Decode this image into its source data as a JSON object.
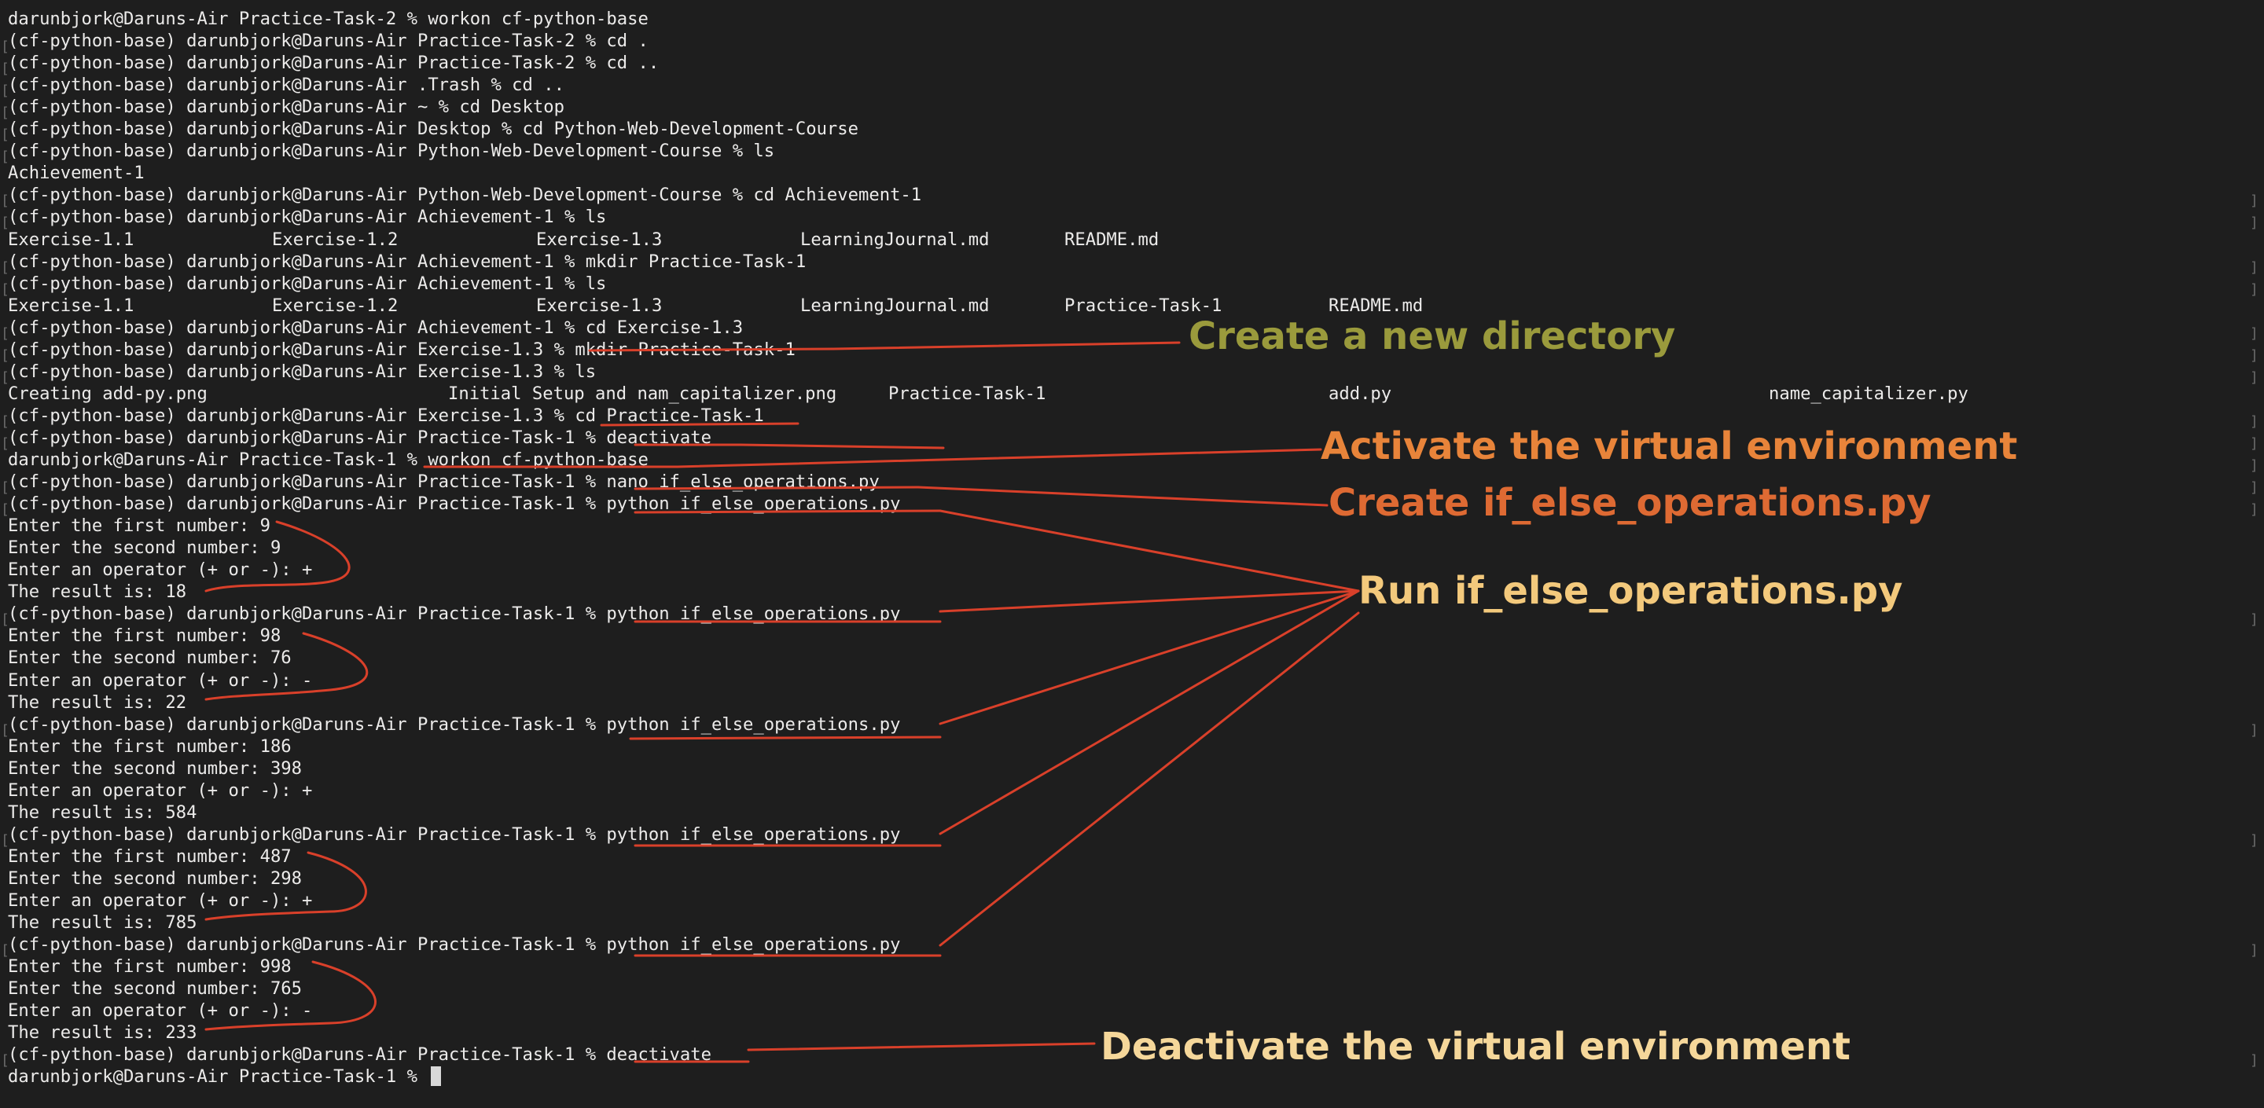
{
  "colors": {
    "background": "#1e1e1e",
    "text": "#ecebea",
    "annotation_line": "#d9402a",
    "annotation_olive": "#9a9a3c",
    "annotation_orange": "#e8843a",
    "annotation_orange_dark": "#de6a33",
    "annotation_yellow": "#f3c97c",
    "annotation_cream": "#f5d79a"
  },
  "terminal": {
    "lines": [
      "darunbjork@Daruns-Air Practice-Task-2 % workon cf-python-base",
      "(cf-python-base) darunbjork@Daruns-Air Practice-Task-2 % cd .",
      "(cf-python-base) darunbjork@Daruns-Air Practice-Task-2 % cd ..",
      "(cf-python-base) darunbjork@Daruns-Air .Trash % cd ..",
      "(cf-python-base) darunbjork@Daruns-Air ~ % cd Desktop",
      "(cf-python-base) darunbjork@Daruns-Air Desktop % cd Python-Web-Development-Course",
      "(cf-python-base) darunbjork@Daruns-Air Python-Web-Development-Course % ls",
      "Achievement-1",
      "(cf-python-base) darunbjork@Daruns-Air Python-Web-Development-Course % cd Achievement-1",
      "(cf-python-base) darunbjork@Daruns-Air Achievement-1 % ls",
      [
        "Exercise-1.1",
        "Exercise-1.2",
        "Exercise-1.3",
        "LearningJournal.md",
        "README.md"
      ],
      "(cf-python-base) darunbjork@Daruns-Air Achievement-1 % mkdir Practice-Task-1",
      "(cf-python-base) darunbjork@Daruns-Air Achievement-1 % ls",
      [
        "Exercise-1.1",
        "Exercise-1.2",
        "Exercise-1.3",
        "LearningJournal.md",
        "Practice-Task-1",
        "README.md"
      ],
      "(cf-python-base) darunbjork@Daruns-Air Achievement-1 % cd Exercise-1.3",
      "(cf-python-base) darunbjork@Daruns-Air Exercise-1.3 % mkdir Practice-Task-1",
      "(cf-python-base) darunbjork@Daruns-Air Exercise-1.3 % ls",
      [
        "Creating add-py.png",
        "Initial Setup and nam_capitalizer.png",
        "Practice-Task-1",
        "add.py",
        "name_capitalizer.py"
      ],
      "(cf-python-base) darunbjork@Daruns-Air Exercise-1.3 % cd Practice-Task-1",
      "(cf-python-base) darunbjork@Daruns-Air Practice-Task-1 % deactivate",
      "darunbjork@Daruns-Air Practice-Task-1 % workon cf-python-base",
      "(cf-python-base) darunbjork@Daruns-Air Practice-Task-1 % nano if_else_operations.py",
      "(cf-python-base) darunbjork@Daruns-Air Practice-Task-1 % python if_else_operations.py",
      "Enter the first number: 9",
      "Enter the second number: 9",
      "Enter an operator (+ or -): +",
      "The result is: 18",
      "(cf-python-base) darunbjork@Daruns-Air Practice-Task-1 % python if_else_operations.py",
      "Enter the first number: 98",
      "Enter the second number: 76",
      "Enter an operator (+ or -): -",
      "The result is: 22",
      "(cf-python-base) darunbjork@Daruns-Air Practice-Task-1 % python if_else_operations.py",
      "Enter the first number: 186",
      "Enter the second number: 398",
      "Enter an operator (+ or -): +",
      "The result is: 584",
      "(cf-python-base) darunbjork@Daruns-Air Practice-Task-1 % python if_else_operations.py",
      "Enter the first number: 487",
      "Enter the second number: 298",
      "Enter an operator (+ or -): +",
      "The result is: 785",
      "(cf-python-base) darunbjork@Daruns-Air Practice-Task-1 % python if_else_operations.py",
      "Enter the first number: 998",
      "Enter the second number: 765",
      "Enter an operator (+ or -): -",
      "The result is: 233",
      "(cf-python-base) darunbjork@Daruns-Air Practice-Task-1 % deactivate",
      "darunbjork@Daruns-Air Practice-Task-1 % "
    ]
  },
  "annotations": {
    "create_dir": "Create a new directory",
    "activate": "Activate the virtual environment",
    "create_file": "Create if_else_operations.py",
    "run_file": "Run if_else_operations.py",
    "deactivate": "Deactivate the virtual environment"
  }
}
